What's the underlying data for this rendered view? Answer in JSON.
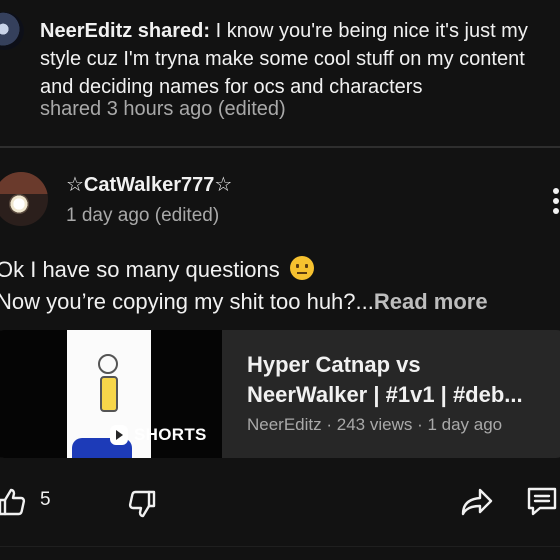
{
  "reply": {
    "author": "NeerEditz",
    "verb": " shared:",
    "text": " I know you're being nice it's just my style cuz I'm tryna make some cool stuff on my content and deciding names for ocs and characters",
    "time": "shared 3 hours ago (edited)"
  },
  "comment": {
    "author": "☆CatWalker777☆",
    "time": "1 day ago (edited)",
    "line1": "Ok I have so many questions",
    "emoji_icon": "neutral-face-emoji",
    "line2": "Now you’re copying my shit too huh?...",
    "read_more": "Read more"
  },
  "video": {
    "badge": "SHORTS",
    "title_line1": "Hyper Catnap vs",
    "title_line2": "NeerWalker | #1v1 | #deb...",
    "meta": "NeerEditz  · 243 views · 1 day ago"
  },
  "actions": {
    "like_icon": "thumbs-up-icon",
    "like_count": "5",
    "dislike_icon": "thumbs-down-icon",
    "share_icon": "share-icon",
    "reply_icon": "comment-icon"
  },
  "colors": {
    "background": "#121212",
    "text": "#f1f1f1",
    "muted": "#a9a9a9",
    "card": "#272727"
  }
}
